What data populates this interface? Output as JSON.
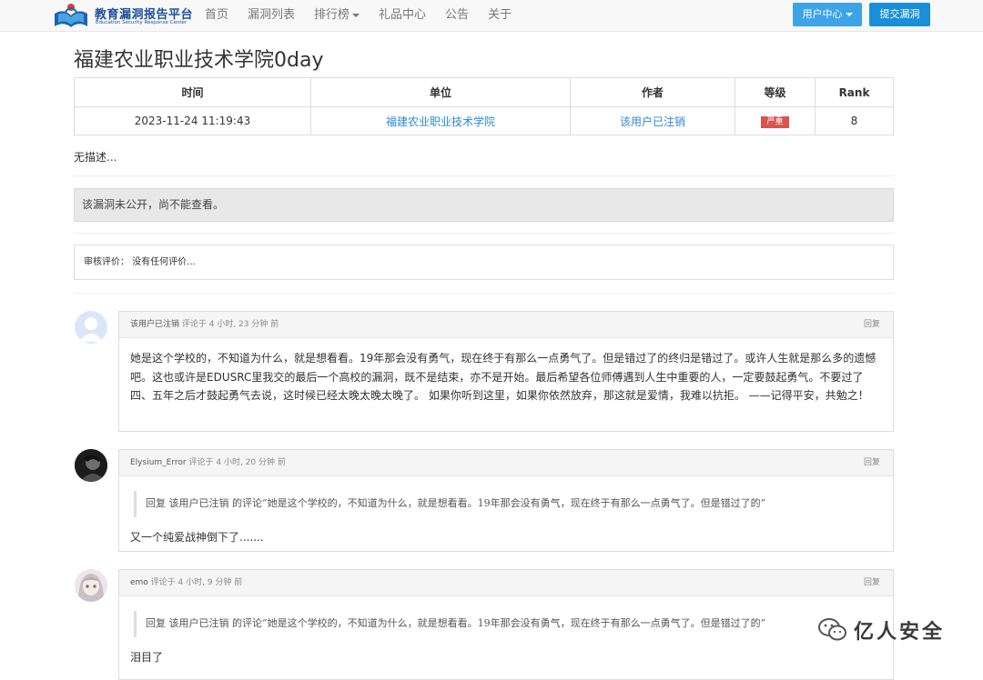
{
  "nav": {
    "logo_title": "教育漏洞报告平台",
    "logo_subtitle": "Education Security Response Center",
    "links": [
      "首页",
      "漏洞列表",
      "排行榜",
      "礼品中心",
      "公告",
      "关于"
    ],
    "user_center": "用户中心",
    "submit": "提交漏洞"
  },
  "vuln": {
    "title": "福建农业职业技术学院0day",
    "headers": [
      "时间",
      "单位",
      "作者",
      "等级",
      "Rank"
    ],
    "time": "2023-11-24 11:19:43",
    "unit": "福建农业职业技术学院",
    "author": "该用户已注销",
    "level": "严重",
    "level_color": "#d9534f",
    "rank": "8",
    "description": "无描述...",
    "notice": "该漏洞未公开，尚不能查看。",
    "review_label": "审核评价：",
    "review_text": "没有任何评价..."
  },
  "comments": [
    {
      "author": "该用户已注销",
      "meta": "评论于 4 小时, 23 分钟 前",
      "reply": "回复",
      "text": "她是这个学校的，不知道为什么，就是想看看。19年那会没有勇气，现在终于有那么一点勇气了。但是错过了的终归是错过了。或许人生就是那么多的遗憾吧。这也或许是EDUSRC里我交的最后一个高校的漏洞，既不是结束，亦不是开始。最后希望各位师傅遇到人生中重要的人，一定要鼓起勇气。不要过了四、五年之后才鼓起勇气去说，这时候已经太晚太晚太晚了。 如果你听到这里，如果你依然放弃，那这就是爱情，我难以抗拒。 ——记得平安，共勉之！"
    },
    {
      "author": "Elysium_Error",
      "meta": "评论于 4 小时, 20 分钟 前",
      "reply": "回复",
      "quote": "回复 该用户已注销 的评论“她是这个学校的，不知道为什么，就是想看看。19年那会没有勇气，现在终于有那么一点勇气了。但是错过了的”",
      "text": "又一个纯爱战神倒下了......."
    },
    {
      "author": "emo",
      "meta": "评论于 4 小时, 9 分钟 前",
      "reply": "回复",
      "quote": "回复 该用户已注销 的评论“她是这个学校的，不知道为什么，就是想看看。19年那会没有勇气，现在终于有那么一点勇气了。但是错过了的”",
      "text": "泪目了"
    }
  ],
  "watermark": "亿人安全"
}
